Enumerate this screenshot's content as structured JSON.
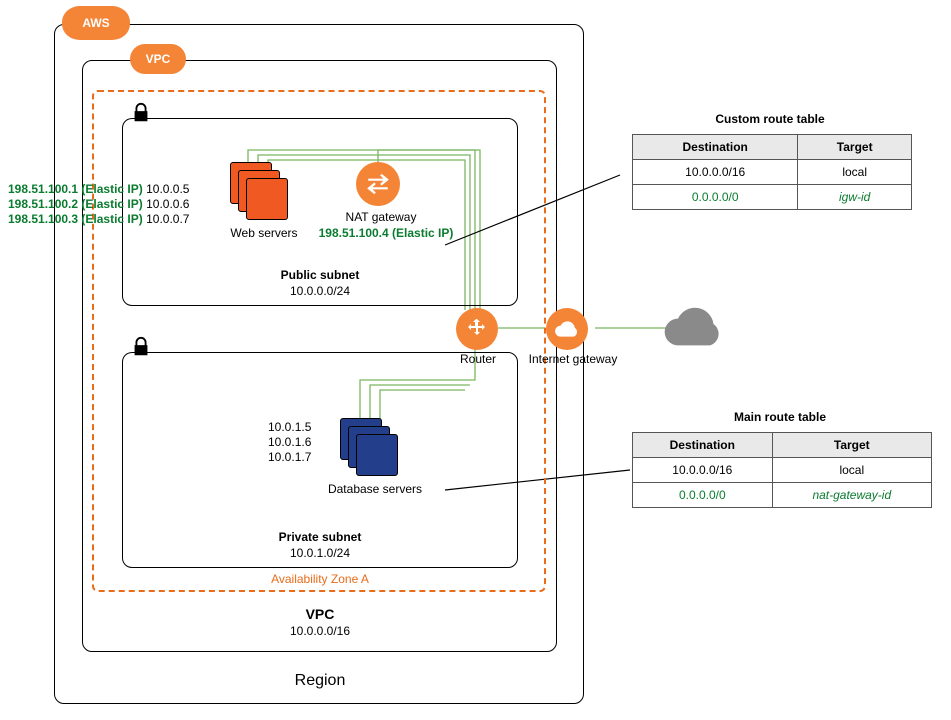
{
  "aws_label": "AWS",
  "vpc_badge": "VPC",
  "region_label": "Region",
  "vpc_label": "VPC",
  "vpc_cidr": "10.0.0.0/16",
  "az_label": "Availability Zone A",
  "public_subnet": {
    "title": "Public subnet",
    "cidr": "10.0.0.0/24"
  },
  "private_subnet": {
    "title": "Private  subnet",
    "cidr": "10.0.1.0/24"
  },
  "web_servers_label": "Web servers",
  "nat_label": "NAT gateway",
  "nat_eip": "198.51.100.4 (Elastic IP)",
  "db_servers_label": "Database servers",
  "router_label": "Router",
  "igw_label": "Internet gateway",
  "elastic_ips": [
    {
      "eip": "198.51.100.1 (Elastic IP)",
      "priv": "10.0.0.5"
    },
    {
      "eip": "198.51.100.2 (Elastic IP)",
      "priv": "10.0.0.6"
    },
    {
      "eip": "198.51.100.3 (Elastic IP)",
      "priv": "10.0.0.7"
    }
  ],
  "db_ips": [
    "10.0.1.5",
    "10.0.1.6",
    "10.0.1.7"
  ],
  "custom_rt": {
    "title": "Custom route table",
    "head": {
      "dest": "Destination",
      "target": "Target"
    },
    "rows": [
      {
        "dest": "10.0.0.0/16",
        "target": "local",
        "highlight": false
      },
      {
        "dest": "0.0.0.0/0",
        "target": "igw-id",
        "highlight": true
      }
    ]
  },
  "main_rt": {
    "title": "Main route table",
    "head": {
      "dest": "Destination",
      "target": "Target"
    },
    "rows": [
      {
        "dest": "10.0.0.0/16",
        "target": "local",
        "highlight": false
      },
      {
        "dest": "0.0.0.0/0",
        "target": "nat-gateway-id",
        "highlight": true
      }
    ]
  }
}
